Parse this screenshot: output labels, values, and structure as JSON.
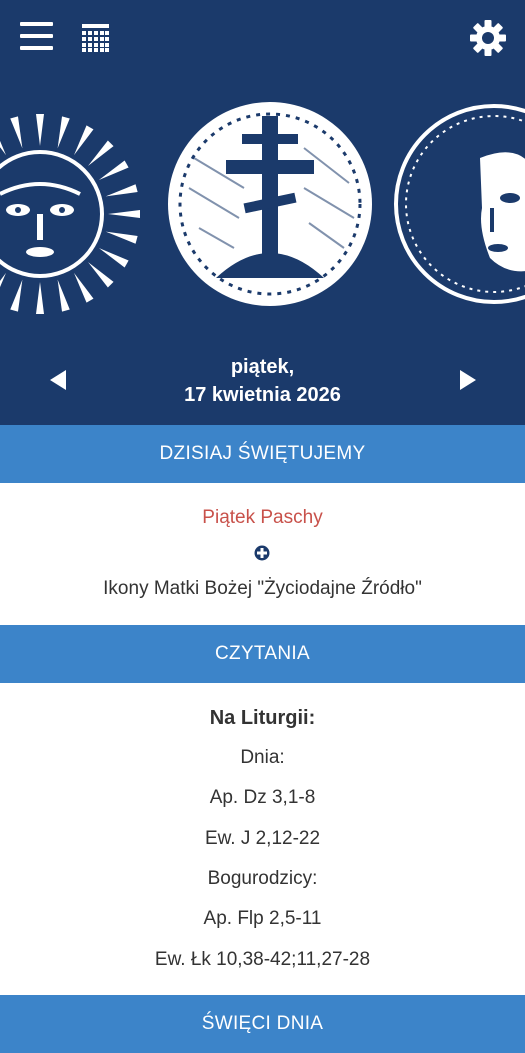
{
  "topbar": {
    "menu_icon": "hamburger-menu-icon",
    "calendar_icon": "calendar-grid-icon",
    "settings_icon": "gear-icon"
  },
  "date": {
    "line1": "piątek,",
    "line2": "17 kwietnia 2026"
  },
  "sections": {
    "celebrate": "DZISIAJ ŚWIĘTUJEMY",
    "readings": "CZYTANIA",
    "saints": "ŚWIĘCI DNIA"
  },
  "feast": {
    "main": "Piątek Paschy",
    "sub": "Ikony Matki Bożej \"Życiodajne Źródło\""
  },
  "readings": {
    "title": "Na Liturgii:",
    "items": [
      "Dnia:",
      "Ap. Dz 3,1-8",
      "Ew. J 2,12-22",
      "Bogurodzicy:",
      "Ap. Flp 2,5-11",
      "Ew. Łk 10,38-42;11,27-28"
    ]
  },
  "colors": {
    "header_bg": "#1b3a6b",
    "section_bar": "#3c84c9",
    "feast_red": "#c8514a"
  }
}
